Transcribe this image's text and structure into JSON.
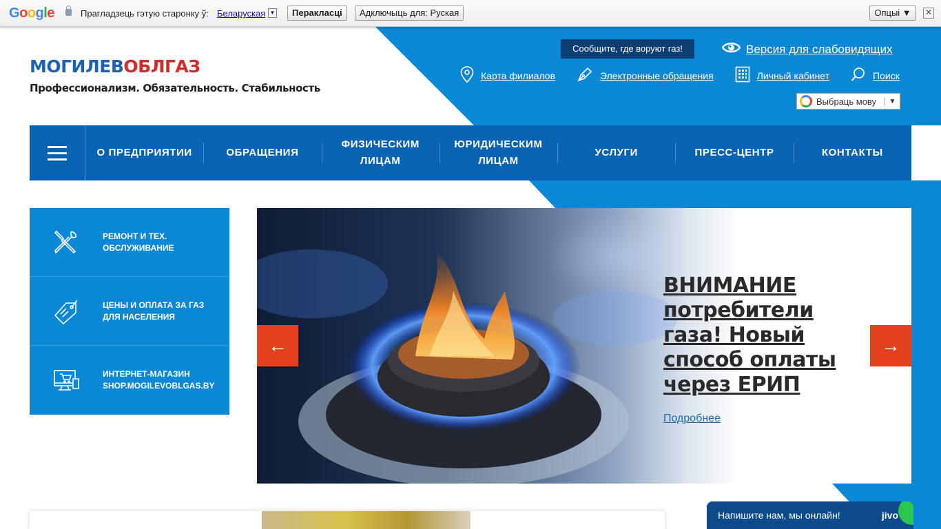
{
  "translate_bar": {
    "logo": "Google",
    "prompt": "Прагладзець гэтую старонку ў:",
    "language": "Беларуская",
    "translate_button": "Перакласці",
    "disable_button": "Адключыць для: Руская",
    "options_button": "Опцыі ▼",
    "close": "✕"
  },
  "header": {
    "logo_part1": "МОГИЛЕВ",
    "logo_part2": "ОБЛГАЗ",
    "tagline": "Профессионализм. Обязательность. Стабильность",
    "gas_theft_button": "Сообщите, где воруют газ!",
    "vision_link": "Версия для слабовидящих",
    "links": [
      {
        "label": "Карта филиалов",
        "icon": "map-pin-icon"
      },
      {
        "label": "Электронные обращения",
        "icon": "pen-icon"
      },
      {
        "label": "Личный кабинет",
        "icon": "building-icon"
      },
      {
        "label": "Поиск",
        "icon": "search-icon"
      }
    ],
    "language_select": "Выбраць мову",
    "language_arrow": "▼"
  },
  "nav": {
    "items": [
      {
        "label": "О ПРЕДПРИЯТИИ"
      },
      {
        "label": "ОБРАЩЕНИЯ"
      },
      {
        "label": "ФИЗИЧЕСКИМ ЛИЦАМ"
      },
      {
        "label": "ЮРИДИЧЕСКИМ ЛИЦАМ"
      },
      {
        "label": "УСЛУГИ"
      },
      {
        "label": "ПРЕСС-ЦЕНТР"
      },
      {
        "label": "КОНТАКТЫ"
      }
    ]
  },
  "side_menu": {
    "items": [
      {
        "line1": "Ремонт и тех.",
        "line2": "обслуживание",
        "icon": "tools-icon"
      },
      {
        "line1": "Цены и оплата за газ",
        "line2": "для населения",
        "icon": "price-tag-icon"
      },
      {
        "line1": "Интернет-магазин",
        "line2": "shop.mogilevoblgas.by",
        "icon": "online-shop-icon"
      }
    ]
  },
  "slider": {
    "title": "ВНИМАНИЕ потребители газа! Новый способ оплаты через ЕРИП",
    "more_link": "Подробнее",
    "prev_arrow": "←",
    "next_arrow": "→"
  },
  "chat": {
    "text": "Напишите нам, мы онлайн!",
    "brand": "jivo"
  },
  "colors": {
    "primary_blue": "#0a88d6",
    "nav_blue": "#0863b3",
    "accent_red": "#e3401c",
    "logo_blue": "#1b62b4",
    "logo_red": "#d32a2a"
  }
}
